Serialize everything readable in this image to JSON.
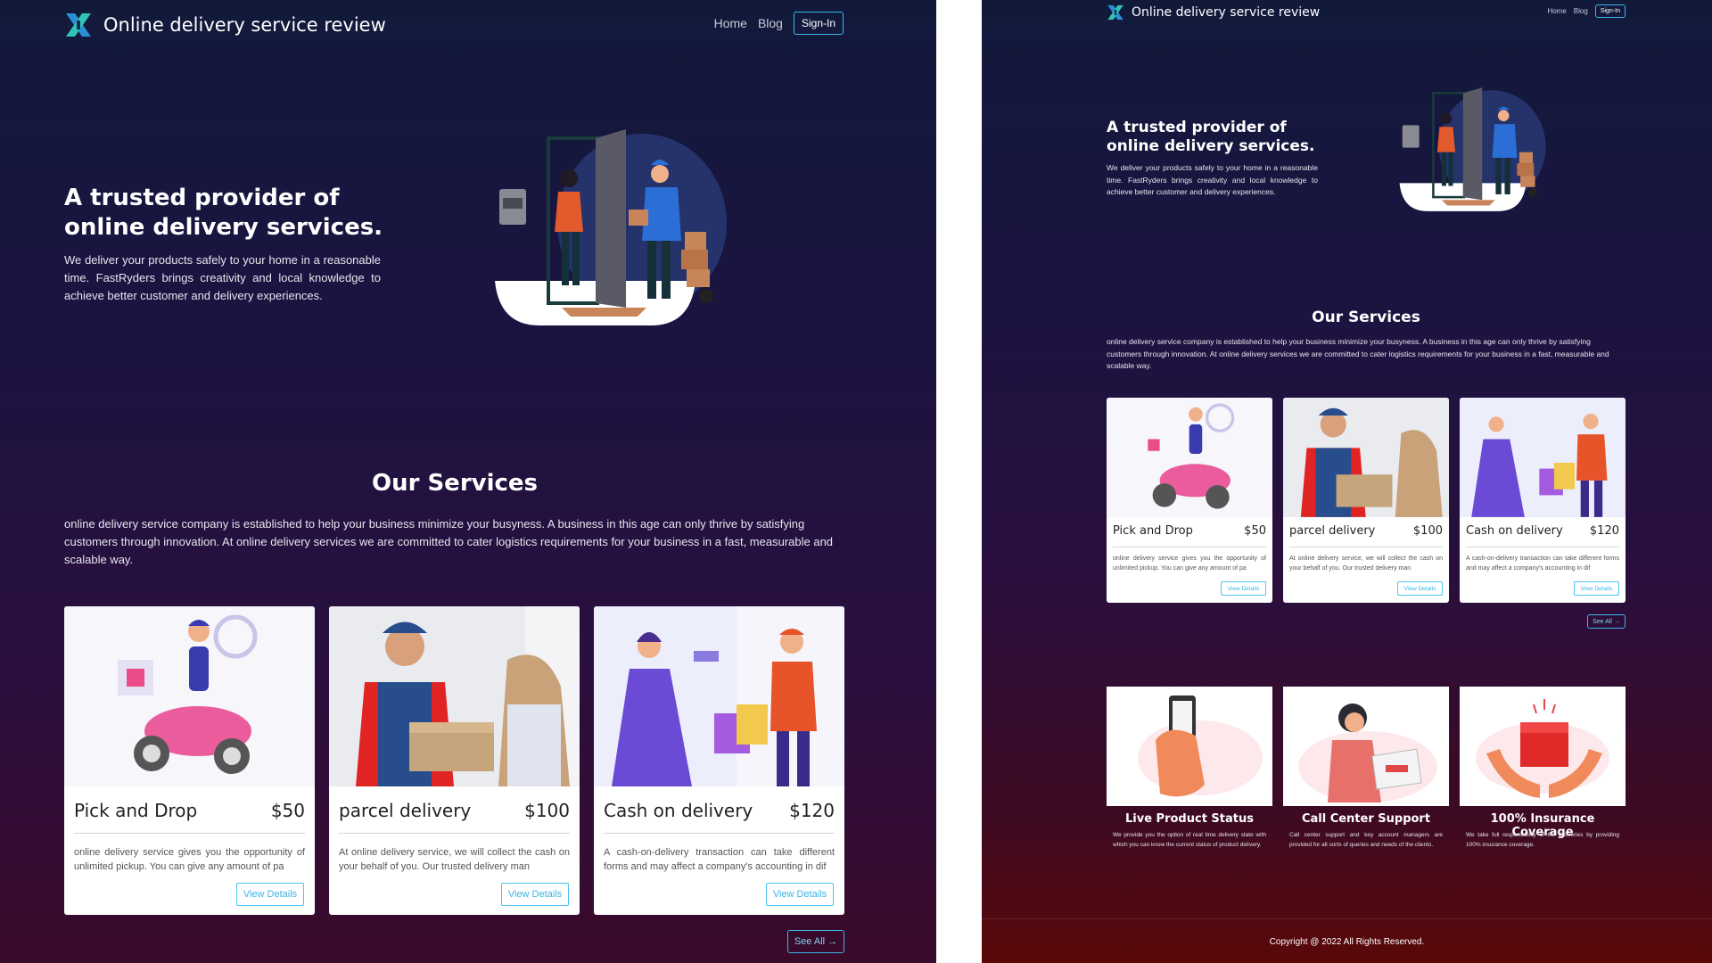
{
  "site": {
    "title": "Online delivery service review",
    "nav": {
      "home": "Home",
      "blog": "Blog",
      "signin": "Sign-In"
    }
  },
  "hero": {
    "title": "A trusted provider of online delivery services.",
    "text": "We deliver your products safely to your home in a reasonable time. FastRyders brings creativity and local knowledge to achieve better customer and delivery experiences."
  },
  "services": {
    "title": "Our Services",
    "text": "online delivery service company is established to help your business minimize your busyness. A business in this age can only thrive by satisfying customers through innovation. At online delivery services we are committed to cater logistics requirements for your business in a fast, measurable and scalable way.",
    "cards": [
      {
        "name": "Pick and Drop",
        "price": "$50",
        "desc": "online delivery service gives you the opportunity of unlimited pickup. You can give any amount of pa",
        "button": "View Details",
        "image": "scooter-courier-illustration"
      },
      {
        "name": "parcel delivery",
        "price": "$100",
        "desc": "At online delivery service, we will collect the cash on your behalf of you. Our trusted delivery man",
        "button": "View Details",
        "image": "parcel-handover-photo"
      },
      {
        "name": "Cash on delivery",
        "price": "$120",
        "desc": "A cash-on-delivery transaction can take different forms and may affect a company's accounting in dif",
        "button": "View Details",
        "image": "cash-handover-illustration"
      }
    ],
    "see_all": "See All →"
  },
  "features": [
    {
      "title": "Live Product Status",
      "text": "We provide you the option of real time delivery state with which you can know the current status of product delivery.",
      "image": "phone-hand-illustration"
    },
    {
      "title": "Call Center Support",
      "text": "Call center support and key account managers are provided for all sorts of queries and needs of the clients.",
      "image": "support-agent-illustration"
    },
    {
      "title": "100% Insurance Coverage",
      "text": "We take full responsibility of the deliveries by providing 100% insurance coverage.",
      "image": "gift-hands-illustration"
    }
  ],
  "footer": {
    "copyright": "Copyright @ 2022 All Rights Reserved."
  },
  "colors": {
    "accent": "#3bb7e8",
    "bg_top": "#121a3b",
    "bg_bottom": "#5a0808",
    "logo_teal": "#2ec4b6"
  }
}
